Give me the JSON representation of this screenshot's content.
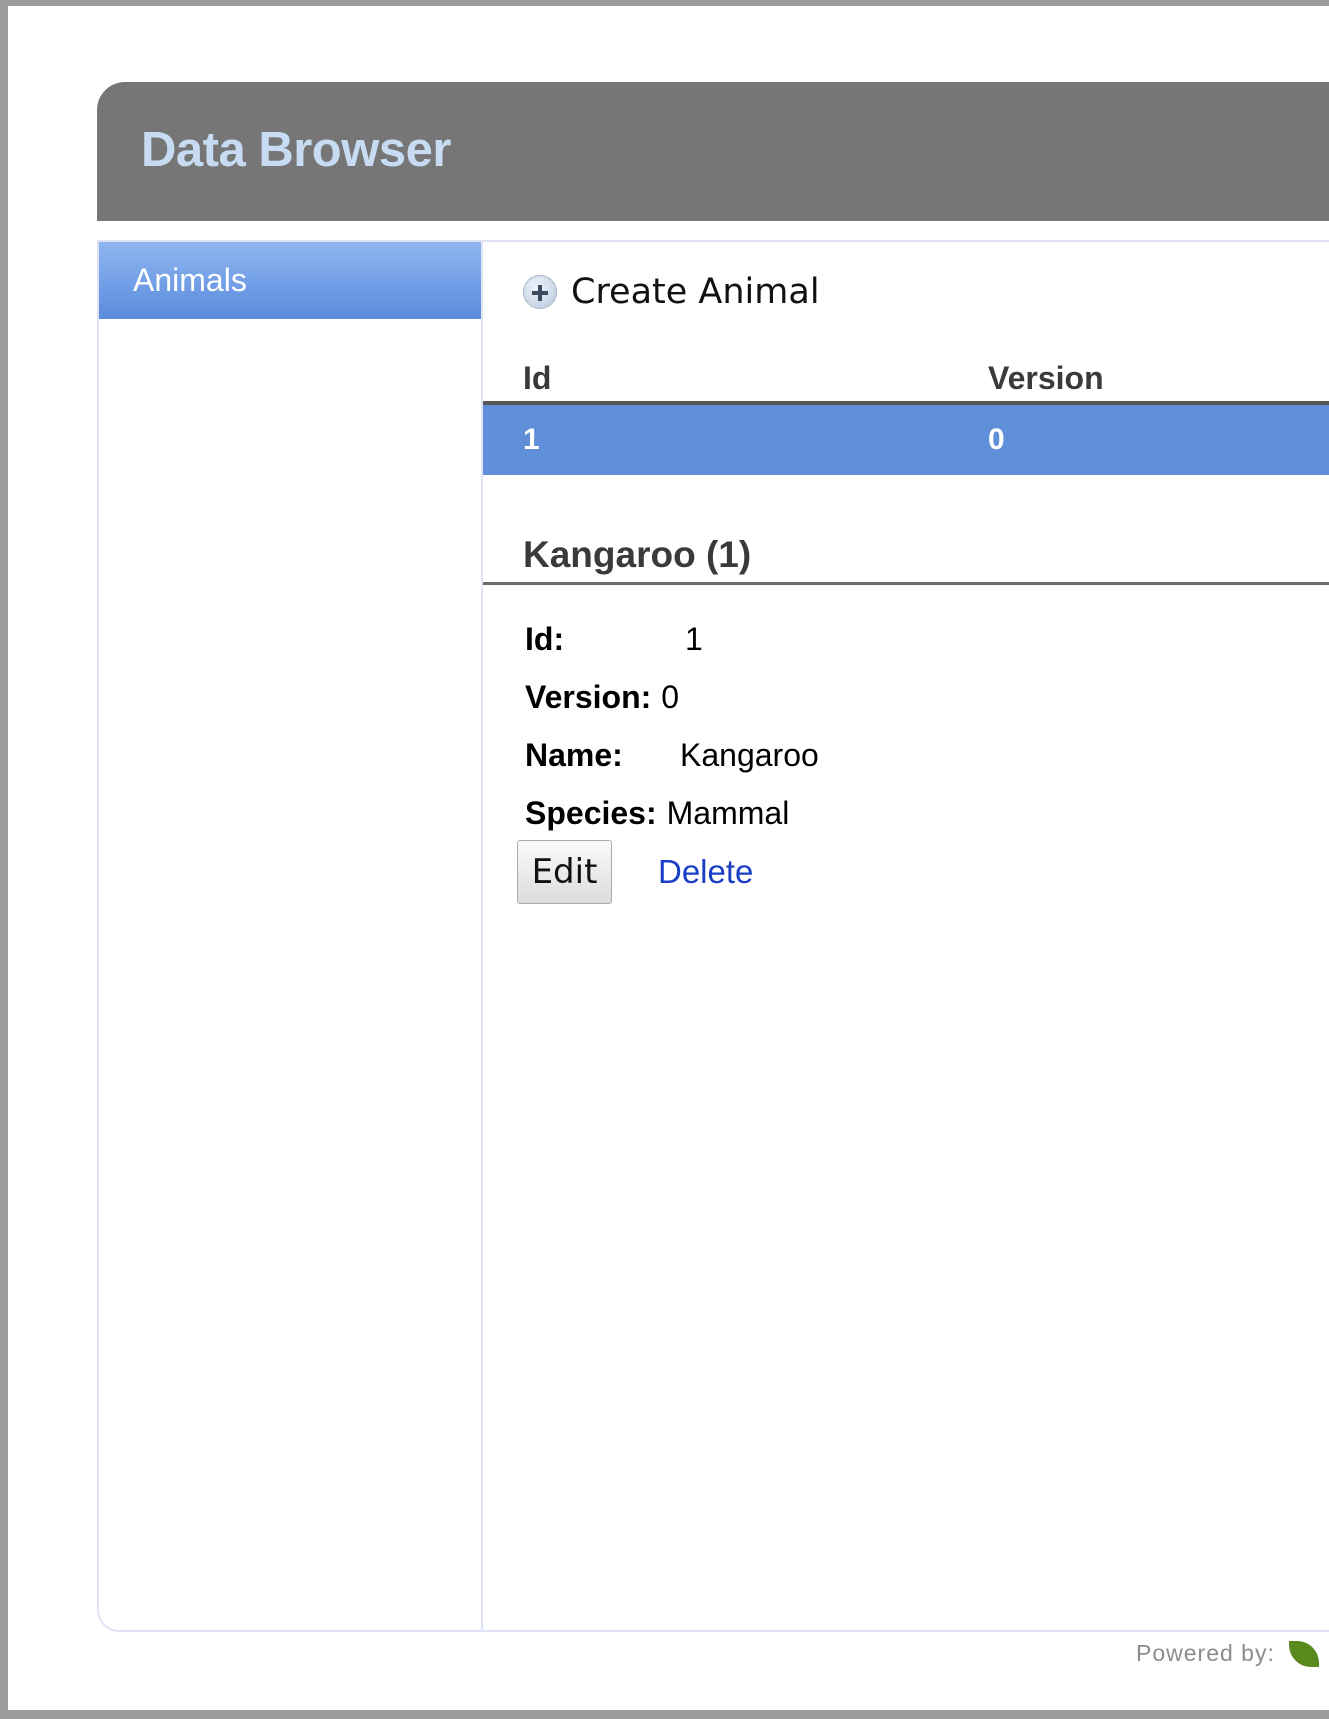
{
  "header": {
    "title": "Data Browser"
  },
  "sidebar": {
    "items": [
      {
        "label": "Animals",
        "selected": true
      }
    ]
  },
  "main": {
    "create_label": "Create Animal",
    "table": {
      "columns": [
        "Id",
        "Version"
      ],
      "rows": [
        {
          "id": "1",
          "version": "0"
        }
      ]
    },
    "detail": {
      "title": "Kangaroo (1)",
      "fields": [
        {
          "label": "Id:",
          "value": "1"
        },
        {
          "label": "Version:",
          "value": "0"
        },
        {
          "label": "Name:",
          "value": "Kangaroo"
        },
        {
          "label": "Species:",
          "value": "Mammal"
        }
      ],
      "edit_label": "Edit",
      "delete_label": "Delete"
    }
  },
  "footer": {
    "powered_by": "Powered by:"
  },
  "icons": {
    "create": "plus-circle-icon",
    "brand": "spring-leaf-icon"
  },
  "colors": {
    "header_bg": "#767676",
    "header_text": "#c7dcf3",
    "selection": "#5f8fd8",
    "link": "#1a3fc6"
  }
}
